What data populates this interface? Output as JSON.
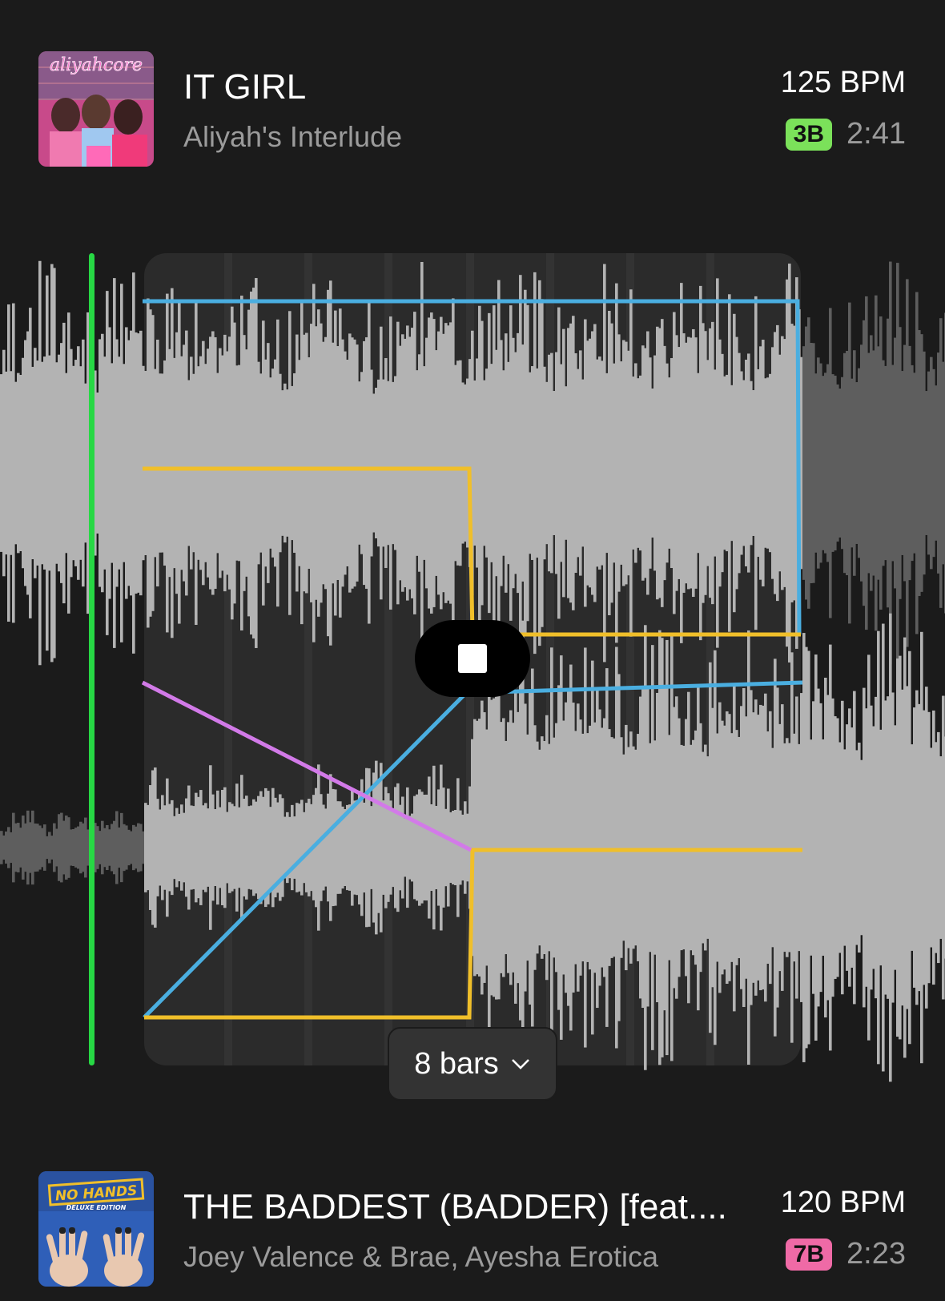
{
  "track_a": {
    "title": "IT GIRL",
    "artist": "Aliyah's Interlude",
    "bpm": "125 BPM",
    "key": "3B",
    "key_color": "#7be15a",
    "duration": "2:41",
    "artwork_icon": "album-art-it-girl",
    "artwork_text": "aliyahcore"
  },
  "track_b": {
    "title": "THE BADDEST (BADDER) [feat....",
    "artist": "Joey Valence & Brae, Ayesha Erotica",
    "bpm": "120 BPM",
    "key": "7B",
    "key_color": "#ef6aa6",
    "duration": "2:23",
    "artwork_icon": "album-art-no-hands",
    "artwork_text": "NO HANDS",
    "artwork_subtext": "DELUXE EDITION"
  },
  "transition": {
    "length_label": "8 bars",
    "stop_icon": "stop-icon",
    "chevron_icon": "chevron-down-icon",
    "colors": {
      "playhead": "#27d844",
      "volume": "#4aaee0",
      "eq": "#f0bf2a",
      "filter": "#d27ae8",
      "waveform": "#b3b3b3",
      "waveform_dim": "#5e5e5e",
      "zone": "#2b2b2b"
    }
  }
}
